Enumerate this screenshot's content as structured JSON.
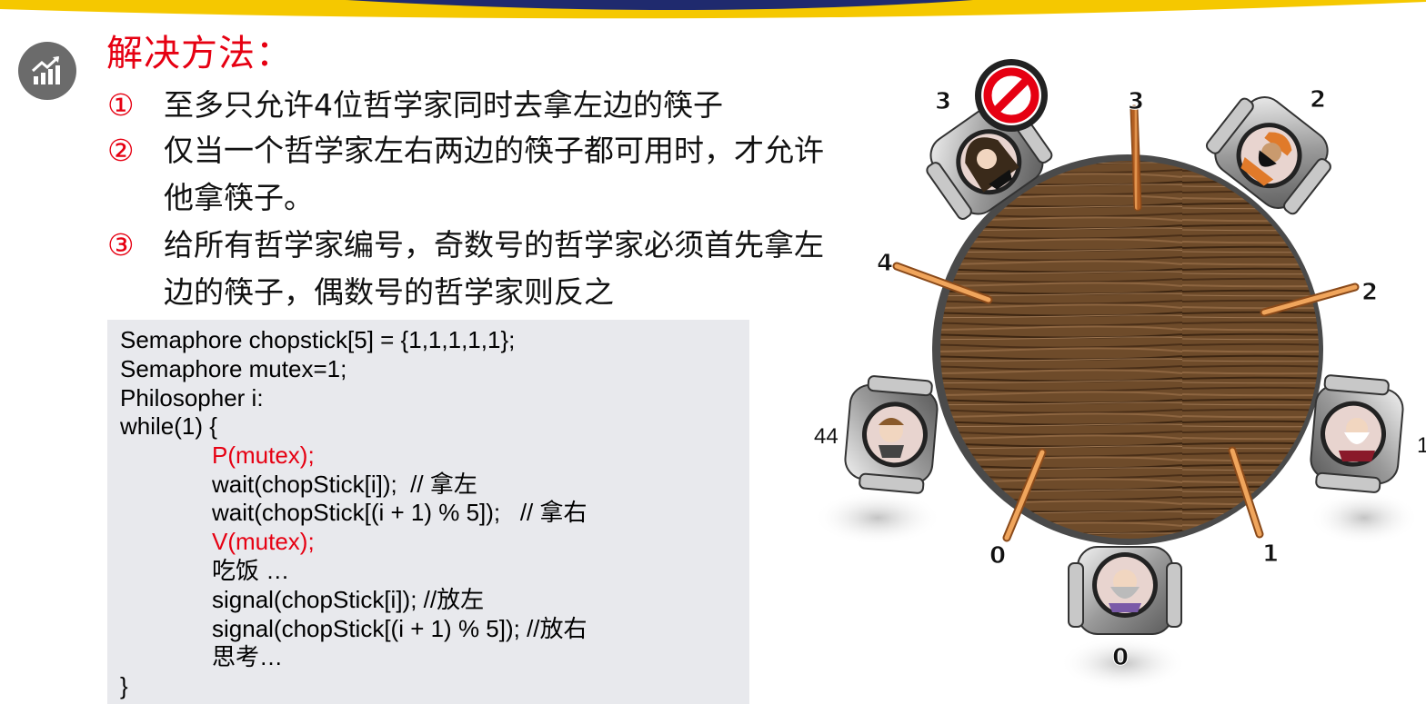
{
  "slide": {
    "title": "解决方法：",
    "icon": "chart-up-icon",
    "items": [
      {
        "num": "①",
        "line1": "至多只允许4位哲学家同时去拿左边的筷子",
        "line2": ""
      },
      {
        "num": "②",
        "line1": "仅当一个哲学家左右两边的筷子都可用时，才允许",
        "line2": "他拿筷子。"
      },
      {
        "num": "③",
        "line1": "给所有哲学家编号，奇数号的哲学家必须首先拿左",
        "line2": "边的筷子，偶数号的哲学家则反之"
      }
    ]
  },
  "code": [
    {
      "text": "Semaphore chopstick[5] = {1,1,1,1,1};",
      "indent": false,
      "red": false
    },
    {
      "text": "Semaphore mutex=1;",
      "indent": false,
      "red": false
    },
    {
      "text": "Philosopher i:",
      "indent": false,
      "red": false
    },
    {
      "text": "while(1) {",
      "indent": false,
      "red": false
    },
    {
      "text": "P(mutex);",
      "indent": true,
      "red": true
    },
    {
      "text": "wait(chopStick[i]);  // 拿左",
      "indent": true,
      "red": false
    },
    {
      "text": "wait(chopStick[(i + 1) % 5]);   // 拿右",
      "indent": true,
      "red": false
    },
    {
      "text": "V(mutex);",
      "indent": true,
      "red": true
    },
    {
      "text": "吃饭 …",
      "indent": true,
      "red": false
    },
    {
      "text": "signal(chopStick[i]); //放左",
      "indent": true,
      "red": false
    },
    {
      "text": "signal(chopStick[(i + 1) % 5]); //放右",
      "indent": true,
      "red": false
    },
    {
      "text": "思考…",
      "indent": true,
      "red": false
    },
    {
      "text": "}",
      "indent": false,
      "red": false
    }
  ],
  "diagram": {
    "philosopher_labels": [
      "0",
      "1",
      "2",
      "3",
      "44"
    ],
    "chopstick_labels": [
      "0",
      "1",
      "2",
      "3",
      "4"
    ],
    "blocked_icon": "no-entry-icon",
    "colors": {
      "accent_red": "#e60012",
      "table": "#6b4a2b",
      "chopstick": "#d9853b",
      "top_band": "#f5c800"
    }
  }
}
